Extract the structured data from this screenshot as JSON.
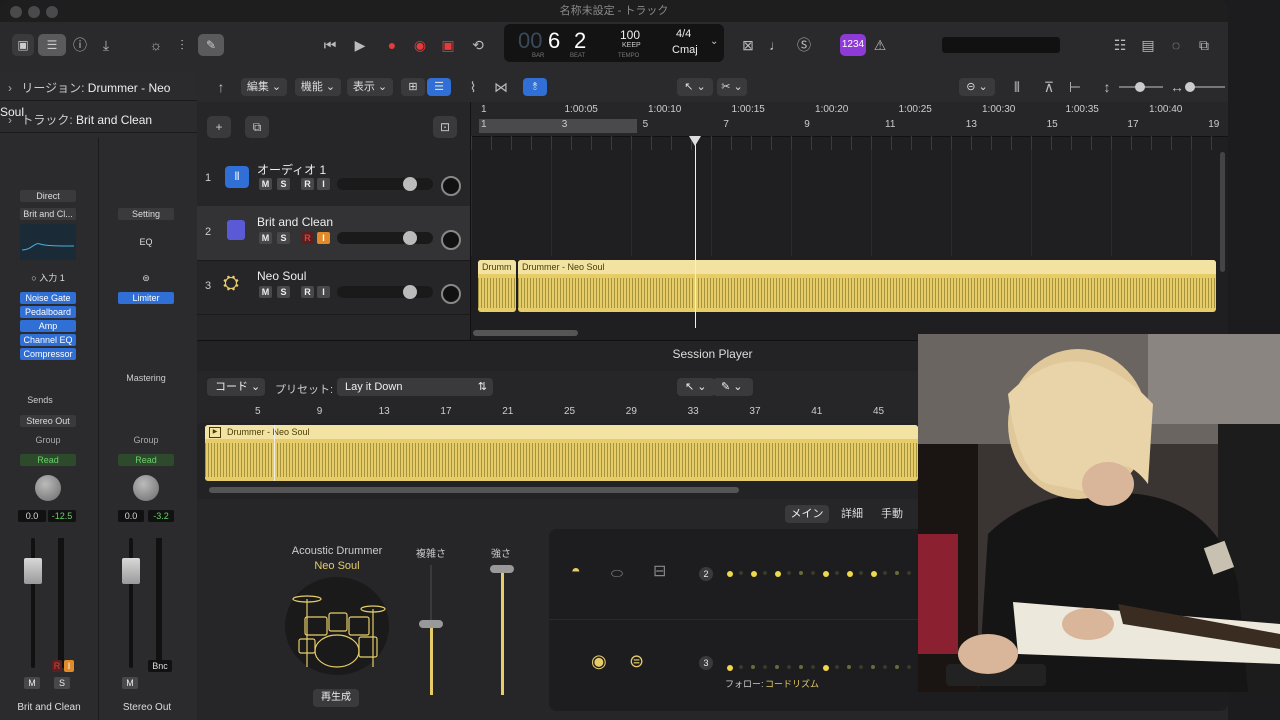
{
  "window": {
    "title": "名称未設定 - トラック"
  },
  "lcd": {
    "bar": "6",
    "beat": "2",
    "bar_label": "BAR",
    "beat_label": "BEAT",
    "ghost_digits": "00",
    "tempo": "100",
    "tempo_mode": "KEEP",
    "tempo_label": "TEMPO",
    "time_sig": "4/4",
    "key": "Cmaj"
  },
  "toolbar": {
    "count_in": "1234"
  },
  "inspector": {
    "region_label": "リージョン:",
    "region_name": "Drummer - Neo Soul",
    "track_label": "トラック:",
    "track_name": "Brit and Clean",
    "strip1": {
      "input_mode": "Direct",
      "patch": "Brit and Cl...",
      "input": "入力 1",
      "plugins": [
        "Noise Gate",
        "Pedalboard",
        "Amp",
        "Channel EQ",
        "Compressor"
      ],
      "sends": "Sends",
      "output": "Stereo Out",
      "group": "Group",
      "automation": "Read",
      "vol": "0.0",
      "peak": "-12.5",
      "mute": "M",
      "solo": "S",
      "name": "Brit and Clean"
    },
    "strip2": {
      "setting": "Setting",
      "eq": "EQ",
      "plugins": [
        "Limiter"
      ],
      "mastering": "Mastering",
      "group": "Group",
      "automation": "Read",
      "vol": "0.0",
      "peak": "-3.2",
      "bounce": "Bnc",
      "mute": "M",
      "name": "Stereo Out"
    }
  },
  "tracks_toolbar": {
    "edit": "編集",
    "function": "機能",
    "view": "表示"
  },
  "tracks": [
    {
      "num": "1",
      "name": "オーディオ 1",
      "volume": 0.8,
      "r": "R",
      "i": "I"
    },
    {
      "num": "2",
      "name": "Brit and Clean",
      "volume": 0.8,
      "r": "R",
      "i": "I"
    },
    {
      "num": "3",
      "name": "Neo Soul",
      "volume": 0.8,
      "r": "R",
      "i": "I"
    }
  ],
  "track_buttons": {
    "mute": "M",
    "solo": "S"
  },
  "ruler": {
    "times": [
      "1",
      "1:00:05",
      "1:00:10",
      "1:00:15",
      "1:00:20",
      "1:00:25",
      "1:00:30",
      "1:00:35",
      "1:00:40"
    ],
    "bars": [
      "1",
      "3",
      "5",
      "7",
      "9",
      "11",
      "13",
      "15",
      "17",
      "19"
    ]
  },
  "regions": {
    "drum_short": "Drumm",
    "drum_main": "Drummer - Neo Soul"
  },
  "editor": {
    "title": "Session Player",
    "mode": "コード",
    "preset_label": "プリセット:",
    "preset": "Lay it Down",
    "bars": [
      "5",
      "9",
      "13",
      "17",
      "21",
      "25",
      "29",
      "33",
      "37",
      "41",
      "45"
    ],
    "region": "Drummer - Neo Soul",
    "tabs": [
      "メイン",
      "詳細",
      "手動"
    ],
    "drummer": "Acoustic Drummer",
    "style": "Neo Soul",
    "complexity": "複雑さ",
    "intensity": "強さ",
    "play": "再生成",
    "row_nums": [
      "2",
      "3"
    ],
    "follow_label": "フォロー:",
    "follow_value": "コードリズム",
    "complexity_level": 0.55,
    "intensity_level": 0.97
  },
  "colors": {
    "accent": "#e6cd6a",
    "blue": "#2f6fd6",
    "record": "#e23c3c",
    "count_in": "#8e3ad6"
  }
}
